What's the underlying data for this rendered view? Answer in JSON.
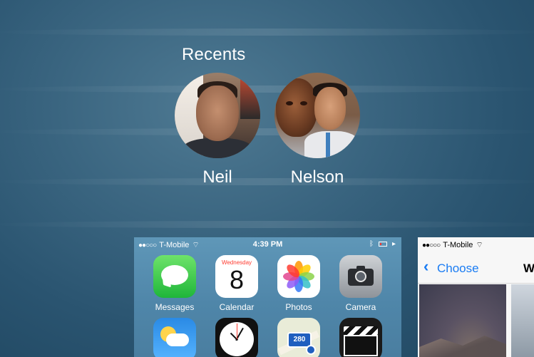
{
  "recents": {
    "title": "Recents",
    "contacts": [
      {
        "name": "Neil"
      },
      {
        "name": "Nelson"
      }
    ]
  },
  "app_switcher_card_1": {
    "status_bar": {
      "carrier": "T-Mobile",
      "signal_dots": "●●○○○",
      "time": "4:39 PM"
    },
    "apps_row_1": [
      {
        "label": "Messages",
        "icon": "messages-icon"
      },
      {
        "label": "Calendar",
        "icon": "calendar-icon",
        "day": "Wednesday",
        "date": "8"
      },
      {
        "label": "Photos",
        "icon": "photos-icon"
      },
      {
        "label": "Camera",
        "icon": "camera-icon"
      }
    ],
    "apps_row_2": [
      {
        "icon": "weather-icon"
      },
      {
        "icon": "clock-icon"
      },
      {
        "icon": "maps-icon",
        "badge": "280"
      },
      {
        "icon": "videos-icon"
      }
    ]
  },
  "app_switcher_card_2": {
    "status_bar": {
      "carrier": "T-Mobile",
      "signal_dots": "●●○○○"
    },
    "nav": {
      "back_label": "Choose",
      "title_fragment": "W"
    }
  },
  "colors": {
    "ios_blue": "#1a7cf3",
    "wallpaper": "#3a6580"
  }
}
